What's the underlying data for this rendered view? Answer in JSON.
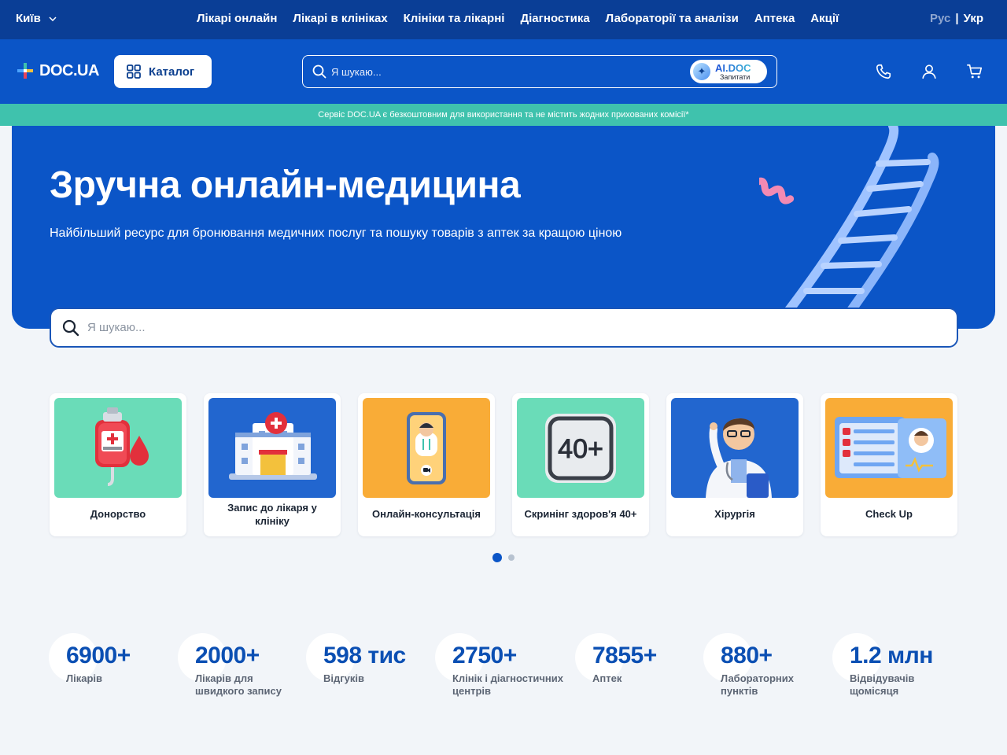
{
  "topnav": {
    "city": "Київ",
    "menu": [
      "Лікарі онлайн",
      "Лікарі в клініках",
      "Клініки та лікарні",
      "Діагностика",
      "Лабораторії та аналізи",
      "Аптека",
      "Акції"
    ],
    "lang_ru": "Рус",
    "lang_sep": "|",
    "lang_uk": "Укр"
  },
  "header": {
    "logo": "DOC.UA",
    "catalog": "Каталог",
    "search_placeholder": "Я шукаю...",
    "aidoc_title": "AI.DOC",
    "aidoc_sub": "Запитати",
    "icons": [
      "phone-icon",
      "user-icon",
      "cart-icon"
    ]
  },
  "notice": "Сервіс DOC.UA є безкоштовним для використання та не містить жодних прихованих комісії*",
  "hero": {
    "title": "Зручна онлайн-медицина",
    "subtitle": "Найбільший ресурс для бронювання медичних послуг та пошуку товарів з аптек за кращою ціною",
    "search_placeholder": "Я шукаю..."
  },
  "categories": [
    {
      "label": "Донорство",
      "color": "#6adcb8"
    },
    {
      "label": "Запис до лікаря у клініку",
      "color": "#2266cf"
    },
    {
      "label": "Онлайн-консультація",
      "color": "#f9ac37"
    },
    {
      "label": "Скринінг здоров'я 40+",
      "color": "#6adcb8"
    },
    {
      "label": "Хірургія",
      "color": "#2266cf"
    },
    {
      "label": "Check Up",
      "color": "#f9ac37"
    }
  ],
  "screening_badge": "40+",
  "carousel": {
    "pages": 2,
    "active": 1
  },
  "stats": [
    {
      "value": "6900+",
      "label": "Лікарів"
    },
    {
      "value": "2000+",
      "label": "Лікарів для швидкого запису"
    },
    {
      "value": "598 тис",
      "label": "Відгуків"
    },
    {
      "value": "2750+",
      "label": "Клінік і діагностичних центрів"
    },
    {
      "value": "7855+",
      "label": "Аптек"
    },
    {
      "value": "880+",
      "label": "Лабораторних пунктів"
    },
    {
      "value": "1.2 млн",
      "label": "Відвідувачів щомісяця"
    }
  ]
}
